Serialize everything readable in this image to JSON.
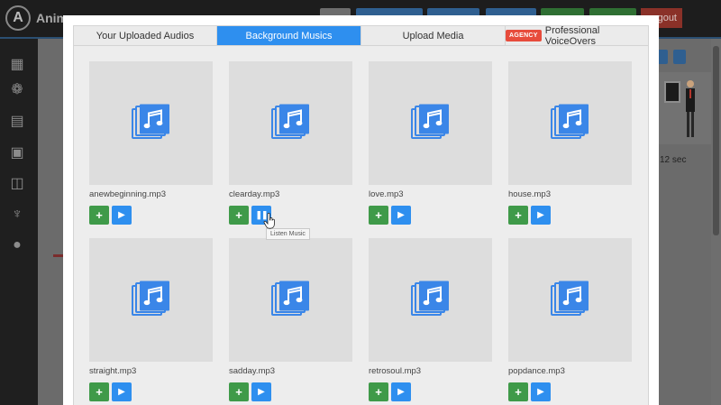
{
  "app": {
    "brand": "Anim",
    "logout_label": "gout",
    "duration_label": "12 sec"
  },
  "colors": {
    "accent": "#2e8fef",
    "add_green": "#3f9a49",
    "agency_red": "#e74c3c"
  },
  "tabs": [
    {
      "label": "Your Uploaded Audios",
      "active": false
    },
    {
      "label": "Background Musics",
      "active": true
    },
    {
      "label": "Upload Media",
      "active": false
    },
    {
      "label": "Professional VoiceOvers",
      "active": false,
      "badge": "AGENCY"
    }
  ],
  "files": [
    {
      "name": "anewbeginning.mp3",
      "state": "play"
    },
    {
      "name": "clearday.mp3",
      "state": "pause"
    },
    {
      "name": "love.mp3",
      "state": "play"
    },
    {
      "name": "house.mp3",
      "state": "play"
    },
    {
      "name": "straight.mp3",
      "state": "play"
    },
    {
      "name": "sadday.mp3",
      "state": "play"
    },
    {
      "name": "retrosoul.mp3",
      "state": "play"
    },
    {
      "name": "popdance.mp3",
      "state": "play"
    }
  ],
  "tooltip": "Listen Music",
  "icons": {
    "file": "music-file-icon",
    "add": "plus-icon",
    "play": "play-icon",
    "pause": "pause-icon"
  }
}
